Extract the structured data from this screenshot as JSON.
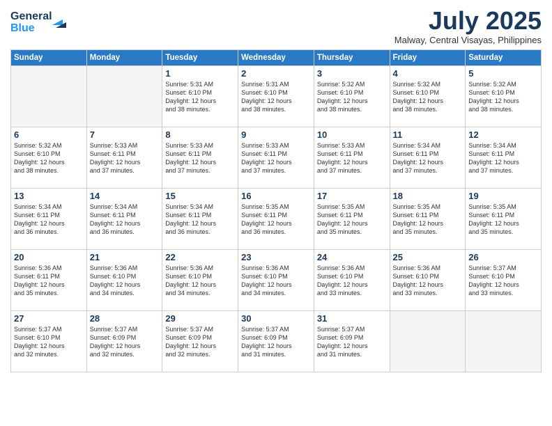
{
  "logo": {
    "line1": "General",
    "line2": "Blue"
  },
  "title": "July 2025",
  "location": "Malway, Central Visayas, Philippines",
  "weekdays": [
    "Sunday",
    "Monday",
    "Tuesday",
    "Wednesday",
    "Thursday",
    "Friday",
    "Saturday"
  ],
  "weeks": [
    [
      {
        "day": null,
        "info": null
      },
      {
        "day": null,
        "info": null
      },
      {
        "day": "1",
        "info": "Sunrise: 5:31 AM\nSunset: 6:10 PM\nDaylight: 12 hours\nand 38 minutes."
      },
      {
        "day": "2",
        "info": "Sunrise: 5:31 AM\nSunset: 6:10 PM\nDaylight: 12 hours\nand 38 minutes."
      },
      {
        "day": "3",
        "info": "Sunrise: 5:32 AM\nSunset: 6:10 PM\nDaylight: 12 hours\nand 38 minutes."
      },
      {
        "day": "4",
        "info": "Sunrise: 5:32 AM\nSunset: 6:10 PM\nDaylight: 12 hours\nand 38 minutes."
      },
      {
        "day": "5",
        "info": "Sunrise: 5:32 AM\nSunset: 6:10 PM\nDaylight: 12 hours\nand 38 minutes."
      }
    ],
    [
      {
        "day": "6",
        "info": "Sunrise: 5:32 AM\nSunset: 6:10 PM\nDaylight: 12 hours\nand 38 minutes."
      },
      {
        "day": "7",
        "info": "Sunrise: 5:33 AM\nSunset: 6:11 PM\nDaylight: 12 hours\nand 37 minutes."
      },
      {
        "day": "8",
        "info": "Sunrise: 5:33 AM\nSunset: 6:11 PM\nDaylight: 12 hours\nand 37 minutes."
      },
      {
        "day": "9",
        "info": "Sunrise: 5:33 AM\nSunset: 6:11 PM\nDaylight: 12 hours\nand 37 minutes."
      },
      {
        "day": "10",
        "info": "Sunrise: 5:33 AM\nSunset: 6:11 PM\nDaylight: 12 hours\nand 37 minutes."
      },
      {
        "day": "11",
        "info": "Sunrise: 5:34 AM\nSunset: 6:11 PM\nDaylight: 12 hours\nand 37 minutes."
      },
      {
        "day": "12",
        "info": "Sunrise: 5:34 AM\nSunset: 6:11 PM\nDaylight: 12 hours\nand 37 minutes."
      }
    ],
    [
      {
        "day": "13",
        "info": "Sunrise: 5:34 AM\nSunset: 6:11 PM\nDaylight: 12 hours\nand 36 minutes."
      },
      {
        "day": "14",
        "info": "Sunrise: 5:34 AM\nSunset: 6:11 PM\nDaylight: 12 hours\nand 36 minutes."
      },
      {
        "day": "15",
        "info": "Sunrise: 5:34 AM\nSunset: 6:11 PM\nDaylight: 12 hours\nand 36 minutes."
      },
      {
        "day": "16",
        "info": "Sunrise: 5:35 AM\nSunset: 6:11 PM\nDaylight: 12 hours\nand 36 minutes."
      },
      {
        "day": "17",
        "info": "Sunrise: 5:35 AM\nSunset: 6:11 PM\nDaylight: 12 hours\nand 35 minutes."
      },
      {
        "day": "18",
        "info": "Sunrise: 5:35 AM\nSunset: 6:11 PM\nDaylight: 12 hours\nand 35 minutes."
      },
      {
        "day": "19",
        "info": "Sunrise: 5:35 AM\nSunset: 6:11 PM\nDaylight: 12 hours\nand 35 minutes."
      }
    ],
    [
      {
        "day": "20",
        "info": "Sunrise: 5:36 AM\nSunset: 6:11 PM\nDaylight: 12 hours\nand 35 minutes."
      },
      {
        "day": "21",
        "info": "Sunrise: 5:36 AM\nSunset: 6:10 PM\nDaylight: 12 hours\nand 34 minutes."
      },
      {
        "day": "22",
        "info": "Sunrise: 5:36 AM\nSunset: 6:10 PM\nDaylight: 12 hours\nand 34 minutes."
      },
      {
        "day": "23",
        "info": "Sunrise: 5:36 AM\nSunset: 6:10 PM\nDaylight: 12 hours\nand 34 minutes."
      },
      {
        "day": "24",
        "info": "Sunrise: 5:36 AM\nSunset: 6:10 PM\nDaylight: 12 hours\nand 33 minutes."
      },
      {
        "day": "25",
        "info": "Sunrise: 5:36 AM\nSunset: 6:10 PM\nDaylight: 12 hours\nand 33 minutes."
      },
      {
        "day": "26",
        "info": "Sunrise: 5:37 AM\nSunset: 6:10 PM\nDaylight: 12 hours\nand 33 minutes."
      }
    ],
    [
      {
        "day": "27",
        "info": "Sunrise: 5:37 AM\nSunset: 6:10 PM\nDaylight: 12 hours\nand 32 minutes."
      },
      {
        "day": "28",
        "info": "Sunrise: 5:37 AM\nSunset: 6:09 PM\nDaylight: 12 hours\nand 32 minutes."
      },
      {
        "day": "29",
        "info": "Sunrise: 5:37 AM\nSunset: 6:09 PM\nDaylight: 12 hours\nand 32 minutes."
      },
      {
        "day": "30",
        "info": "Sunrise: 5:37 AM\nSunset: 6:09 PM\nDaylight: 12 hours\nand 31 minutes."
      },
      {
        "day": "31",
        "info": "Sunrise: 5:37 AM\nSunset: 6:09 PM\nDaylight: 12 hours\nand 31 minutes."
      },
      {
        "day": null,
        "info": null
      },
      {
        "day": null,
        "info": null
      }
    ]
  ]
}
